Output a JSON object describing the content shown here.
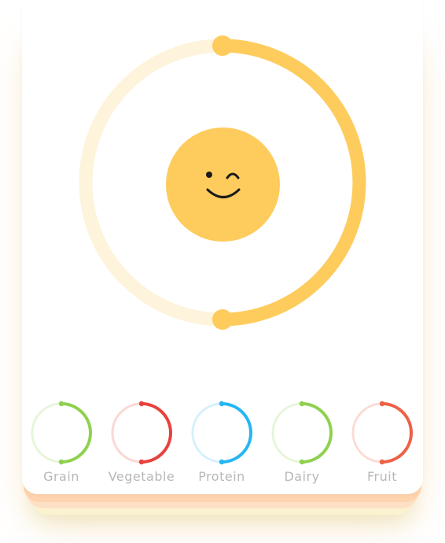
{
  "main_progress": {
    "value": 0.5,
    "color": "#fecc5d",
    "track_color": "#fef3db"
  },
  "mood_face": {
    "color": "#fecc5d",
    "expression": "wink-smile"
  },
  "categories": [
    {
      "label": "Grain",
      "progress": 0.5,
      "color": "#8fd14f",
      "track_color": "#e7f5d9"
    },
    {
      "label": "Vegetable",
      "progress": 0.5,
      "color": "#e8413c",
      "track_color": "#fad7d3"
    },
    {
      "label": "Protein",
      "progress": 0.5,
      "color": "#26b6f2",
      "track_color": "#d6f0fc"
    },
    {
      "label": "Dairy",
      "progress": 0.5,
      "color": "#8fd14f",
      "track_color": "#e7f5d9"
    },
    {
      "label": "Fruit",
      "progress": 0.5,
      "color": "#ee6146",
      "track_color": "#fbdcd4"
    }
  ]
}
